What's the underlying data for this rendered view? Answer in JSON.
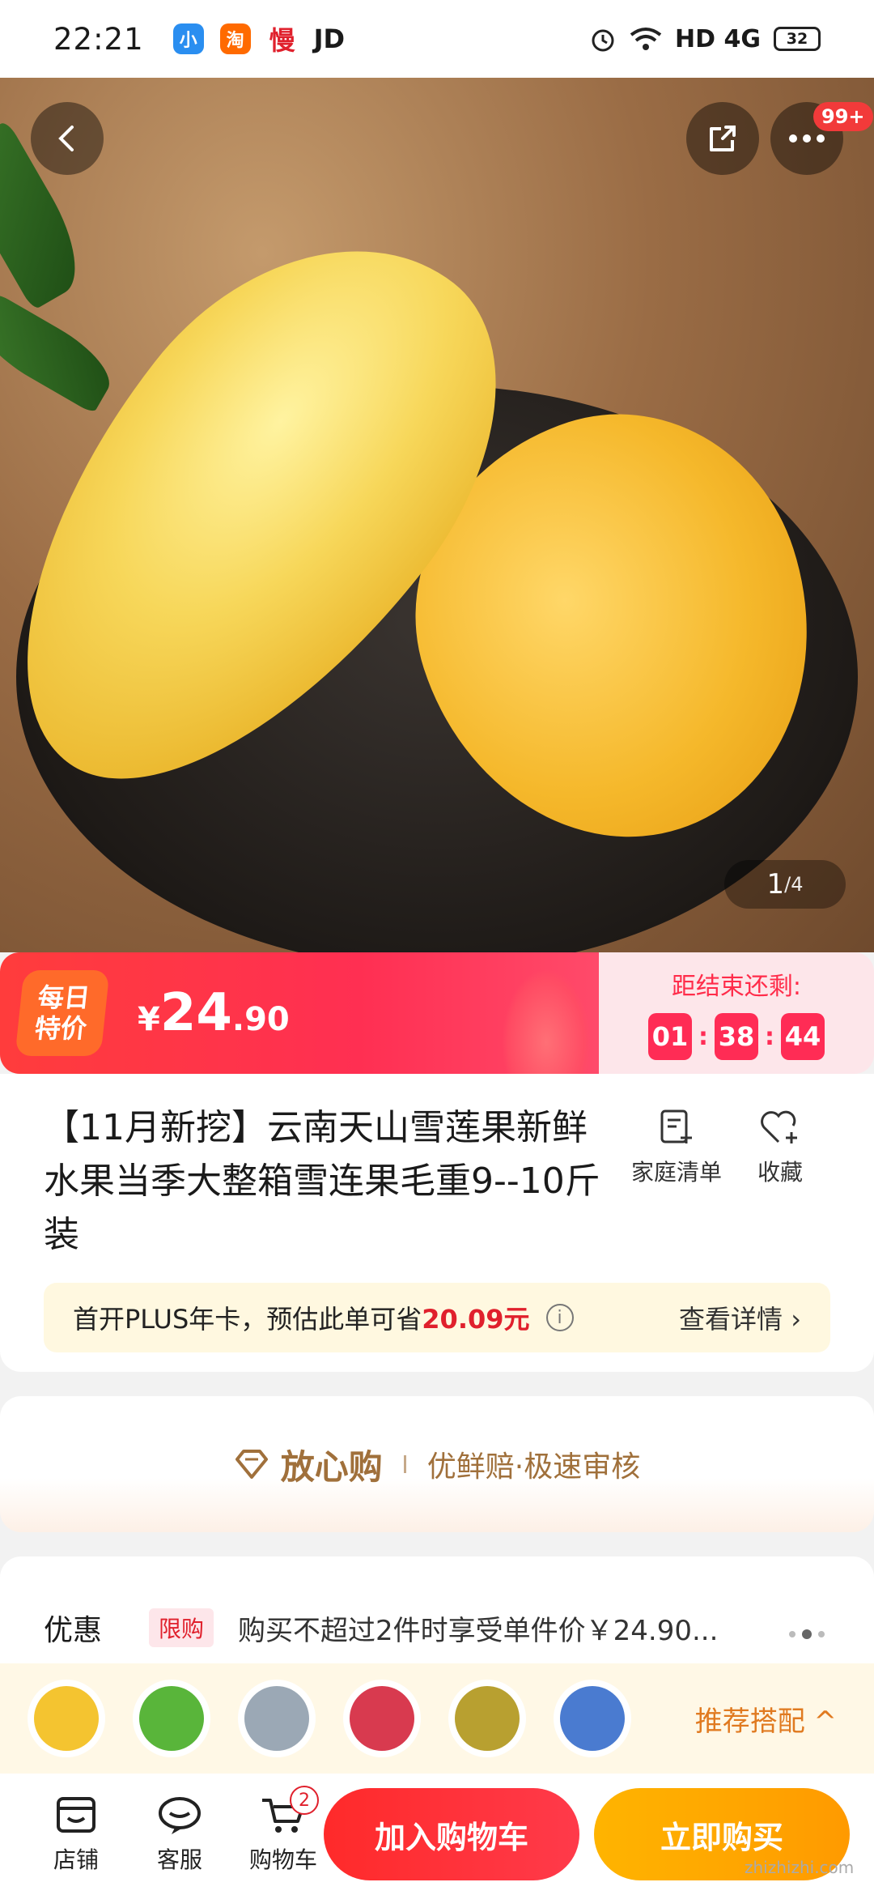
{
  "status_bar": {
    "time": "22:21",
    "app_icons": [
      "小",
      "淘",
      "慢",
      "JD"
    ],
    "network": "HD 4G",
    "battery": "32"
  },
  "gallery": {
    "page_current": "1",
    "page_total": "/4",
    "more_badge": "99+"
  },
  "deal": {
    "tag_line1": "每日",
    "tag_line2": "特价",
    "price_symbol": "¥",
    "price_int": "24",
    "price_dec": ".90",
    "countdown_label": "距结束还剩:",
    "hours": "01",
    "minutes": "38",
    "seconds": "44"
  },
  "product": {
    "title": "【11月新挖】云南天山雪莲果新鲜水果当季大整箱雪连果毛重9--10斤装",
    "actions": [
      {
        "label": "家庭清单"
      },
      {
        "label": "收藏"
      }
    ]
  },
  "plus": {
    "text_prefix": "首开PLUS年卡，预估此单可省",
    "save_amount": "20.09元",
    "info_icon": "i",
    "detail": "查看详情 ›"
  },
  "assurance": {
    "main": "放心购",
    "sub": "优鲜赔·极速审核"
  },
  "promo": {
    "label": "优惠",
    "tag": "限购",
    "desc": "购买不超过2件时享受单件价￥24.90..."
  },
  "recommend": {
    "cta": "推荐搭配 ^",
    "thumb_colors": [
      "#f4c430",
      "#59b53a",
      "#9ba8b5",
      "#d83a4f",
      "#b8a030",
      "#4a7bd0"
    ]
  },
  "bottom_bar": {
    "tabs": [
      {
        "label": "店铺"
      },
      {
        "label": "客服"
      },
      {
        "label": "购物车"
      }
    ],
    "cart_count": "2",
    "add_to_cart": "加入购物车",
    "buy_now": "立即购买"
  },
  "watermark": "zhizhizhi.com"
}
